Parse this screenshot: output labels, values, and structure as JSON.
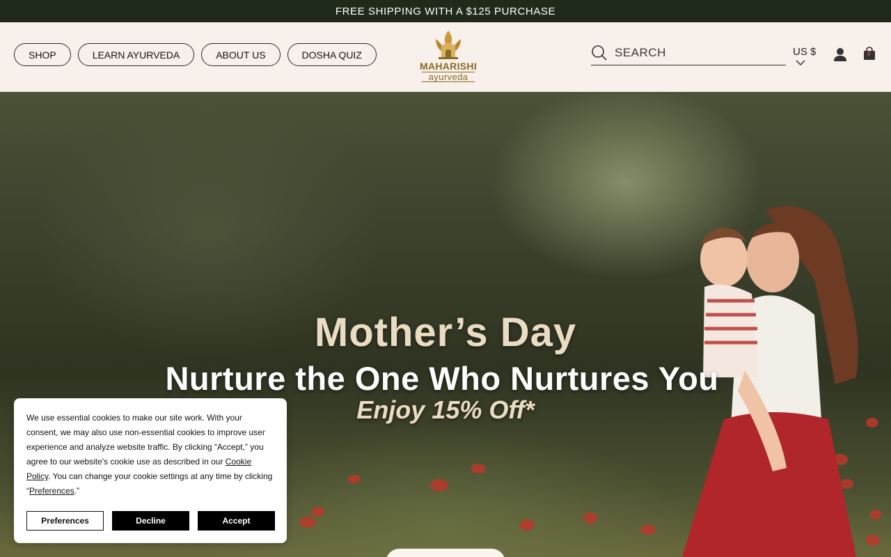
{
  "announcement": {
    "text": "FREE SHIPPING WITH A $125 PURCHASE"
  },
  "nav": {
    "items": [
      {
        "label": "SHOP"
      },
      {
        "label": "LEARN AYURVEDA"
      },
      {
        "label": "ABOUT US"
      },
      {
        "label": "DOSHA QUIZ"
      }
    ]
  },
  "logo": {
    "name": "MAHARISHI",
    "sub": "ayurveda"
  },
  "search": {
    "placeholder": "SEARCH"
  },
  "currency": {
    "label": "US $"
  },
  "cart": {
    "count": "0"
  },
  "hero": {
    "title": "Mother’s Day",
    "subtitle": "Nurture the One Who Nurtures You",
    "offer": "Enjoy 15% Off*"
  },
  "cookie": {
    "text_1": "We use essential cookies to make our site work. With your consent, we may also use non-essential cookies to improve user experience and analyze website traffic. By clicking “Accept,” you agree to our website's cookie use as described in our ",
    "link_cookie_policy": "Cookie Policy",
    "text_2": ". You can change your cookie settings at any time by clicking “",
    "link_preferences": "Preferences",
    "text_3": ".”",
    "preferences_label": "Preferences",
    "decline_label": "Decline",
    "accept_label": "Accept"
  },
  "colors": {
    "announcement_bg": "#1f2a1b",
    "header_bg": "#f8f0ea",
    "brand_gold": "#8a6a22",
    "hero_title": "#eadcc2"
  }
}
